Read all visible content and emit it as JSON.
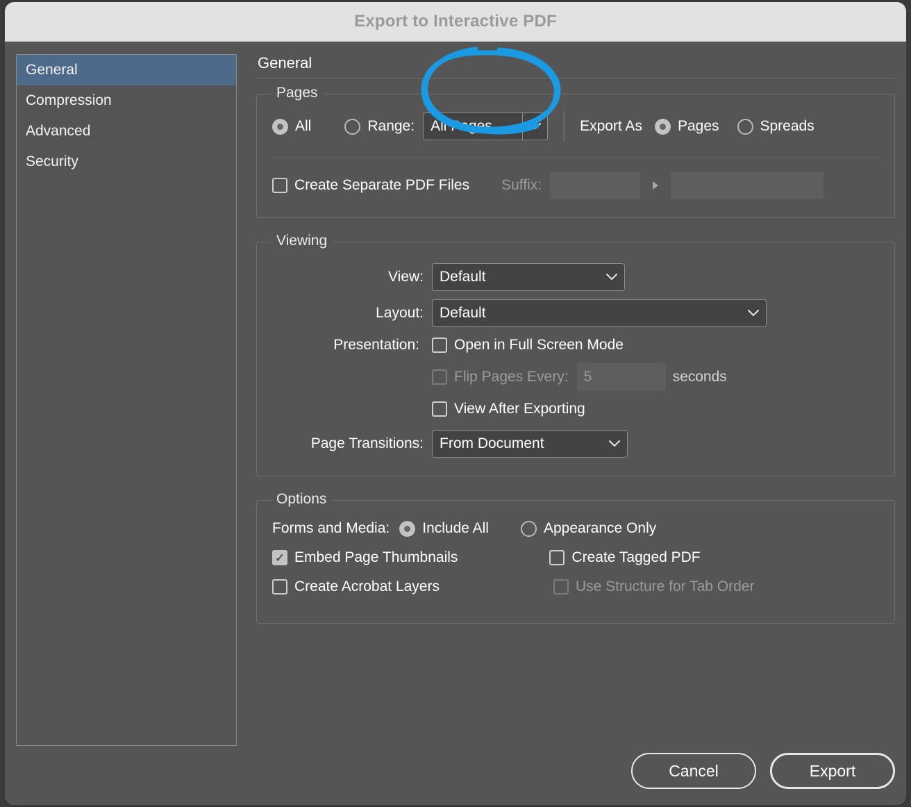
{
  "window": {
    "title": "Export to Interactive PDF"
  },
  "sidebar": {
    "items": [
      {
        "label": "General",
        "selected": true
      },
      {
        "label": "Compression",
        "selected": false
      },
      {
        "label": "Advanced",
        "selected": false
      },
      {
        "label": "Security",
        "selected": false
      }
    ]
  },
  "main": {
    "panel_title": "General",
    "pages": {
      "legend": "Pages",
      "all_label": "All",
      "all_selected": true,
      "range_label": "Range:",
      "range_selected": false,
      "range_value": "All Pages",
      "export_as_label": "Export As",
      "pages_label": "Pages",
      "pages_selected": true,
      "spreads_label": "Spreads",
      "spreads_selected": false,
      "create_separate_label": "Create Separate PDF Files",
      "create_separate_checked": false,
      "suffix_label": "Suffix:",
      "suffix_value": "",
      "suffix_preview_value": "",
      "suffix_arrow_icon": "triangle-right-icon"
    },
    "viewing": {
      "legend": "Viewing",
      "view_label": "View:",
      "view_value": "Default",
      "layout_label": "Layout:",
      "layout_value": "Default",
      "presentation_label": "Presentation:",
      "fullscreen_label": "Open in Full Screen Mode",
      "fullscreen_checked": false,
      "flip_label": "Flip Pages Every:",
      "flip_checked": false,
      "flip_disabled": true,
      "flip_value": "5",
      "seconds_label": "seconds",
      "view_after_label": "View After Exporting",
      "view_after_checked": false,
      "transitions_label": "Page Transitions:",
      "transitions_value": "From Document"
    },
    "options": {
      "legend": "Options",
      "forms_label": "Forms and Media:",
      "include_all_label": "Include All",
      "include_all_selected": true,
      "appearance_only_label": "Appearance Only",
      "appearance_only_selected": false,
      "embed_thumbs_label": "Embed Page Thumbnails",
      "embed_thumbs_checked": true,
      "tagged_pdf_label": "Create Tagged PDF",
      "tagged_pdf_checked": false,
      "acrobat_layers_label": "Create Acrobat Layers",
      "acrobat_layers_checked": false,
      "tab_order_label": "Use Structure for Tab Order",
      "tab_order_checked": false,
      "tab_order_disabled": true
    }
  },
  "footer": {
    "cancel_label": "Cancel",
    "export_label": "Export"
  },
  "annotation": {
    "type": "hand-drawn-ellipse",
    "color": "#1a9ae2",
    "targets": "Pages radio in Export As"
  },
  "colors": {
    "titlebar_bg": "#e2e2e2",
    "dialog_bg": "#555555",
    "selected_nav": "#4e6a8a",
    "text": "#ffffff",
    "disabled_text": "#9b9b9b",
    "annotation_blue": "#1a9ae2"
  }
}
